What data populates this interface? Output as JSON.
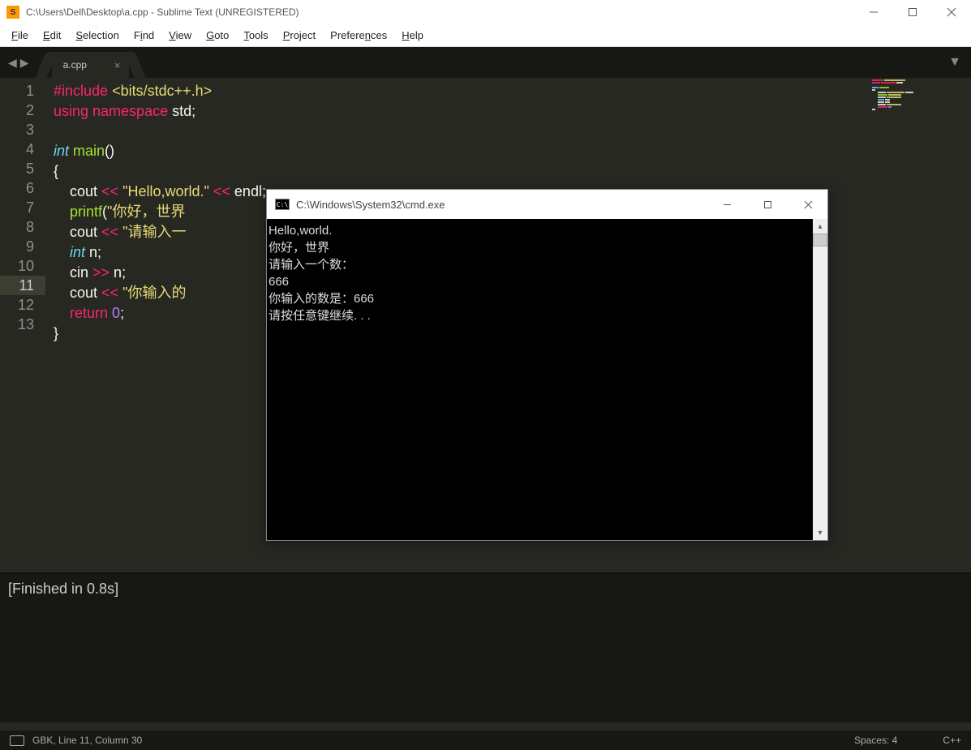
{
  "sublime": {
    "title": "C:\\Users\\Dell\\Desktop\\a.cpp - Sublime Text (UNREGISTERED)",
    "menu": [
      "File",
      "Edit",
      "Selection",
      "Find",
      "View",
      "Goto",
      "Tools",
      "Project",
      "Preferences",
      "Help"
    ],
    "tab_name": "a.cpp",
    "code_lines": {
      "l1_a": "#include",
      "l1_b": " <bits/stdc++.h>",
      "l2_a": "using",
      "l2_b": " namespace",
      "l2_c": " std",
      "l2_d": ";",
      "l4_a": "int",
      "l4_b": " main",
      "l4_c": "()",
      "l5": "{",
      "l6_a": "    cout ",
      "l6_b": "<<",
      "l6_c": " \"Hello,world.\"",
      "l6_d": " <<",
      "l6_e": " endl",
      "l6_f": ";",
      "l7_a": "    ",
      "l7_b": "printf",
      "l7_c": "(",
      "l7_d": "\"你好，世界",
      "l8_a": "    cout ",
      "l8_b": "<<",
      "l8_c": " \"请输入一",
      "l9_a": "    ",
      "l9_b": "int",
      "l9_c": " n",
      "l9_d": ";",
      "l10_a": "    cin ",
      "l10_b": ">>",
      "l10_c": " n",
      "l10_d": ";",
      "l11_a": "    cout ",
      "l11_b": "<<",
      "l11_c": " \"你输入的",
      "l12_a": "    ",
      "l12_b": "return",
      "l12_c": " 0",
      "l12_d": ";",
      "l13": "}"
    },
    "line_numbers": [
      "1",
      "2",
      "3",
      "4",
      "5",
      "6",
      "7",
      "8",
      "9",
      "10",
      "11",
      "12",
      "13"
    ],
    "highlighted_line": 11,
    "output": "[Finished in 0.8s]",
    "status": {
      "left": "GBK, Line 11, Column 30",
      "spaces": "Spaces: 4",
      "lang": "C++"
    }
  },
  "cmd": {
    "title": "C:\\Windows\\System32\\cmd.exe",
    "output_lines": [
      "Hello,world.",
      "你好，世界",
      "请输入一个数：",
      "666",
      "你输入的数是：666",
      "请按任意键继续. . ."
    ]
  }
}
